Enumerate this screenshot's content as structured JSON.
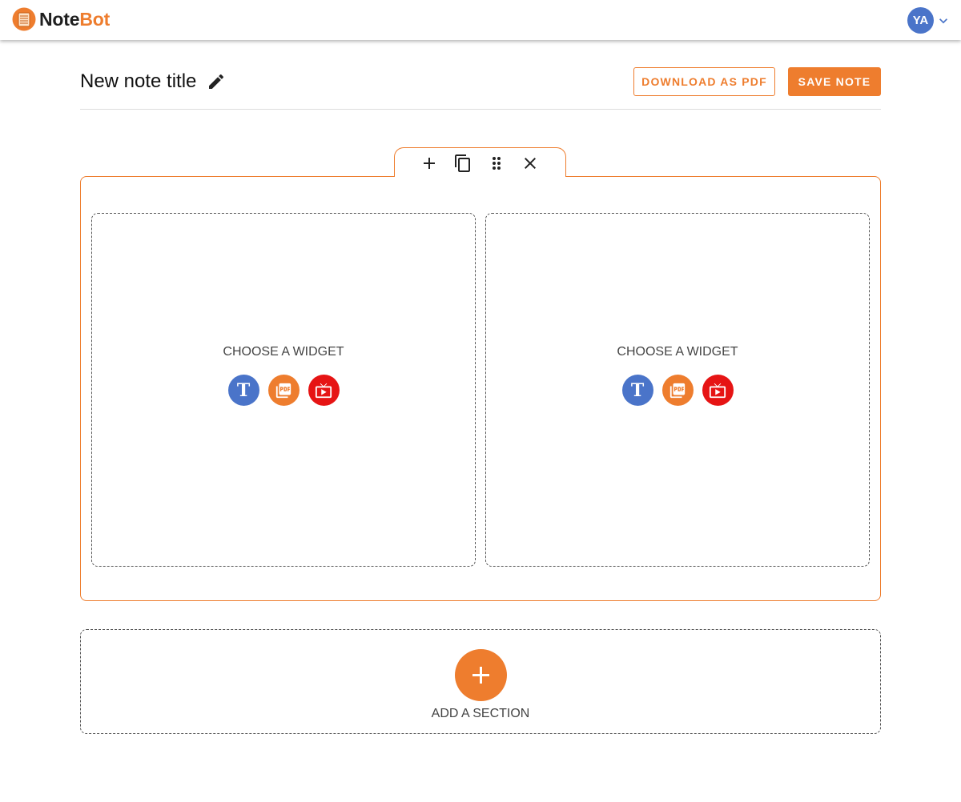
{
  "header": {
    "logo_part1": "Note",
    "logo_part2": "Bot",
    "user_initials": "YA"
  },
  "note": {
    "title": "New note title",
    "download_label": "DOWNLOAD AS PDF",
    "save_label": "SAVE NOTE"
  },
  "section_toolbar": {
    "icons": [
      "plus-icon",
      "copy-icon",
      "drag-handle-icon",
      "close-icon"
    ]
  },
  "columns": [
    {
      "choose_label": "CHOOSE A WIDGET",
      "widgets": [
        "text-widget",
        "pdf-widget",
        "video-widget"
      ]
    },
    {
      "choose_label": "CHOOSE A WIDGET",
      "widgets": [
        "text-widget",
        "pdf-widget",
        "video-widget"
      ]
    }
  ],
  "widget_text_glyph": "T",
  "add_section": {
    "label": "ADD A SECTION"
  },
  "colors": {
    "accent": "#ee7d2e",
    "text_widget": "#4a74c9",
    "video_widget": "#e61414",
    "avatar": "#4a74c9"
  }
}
